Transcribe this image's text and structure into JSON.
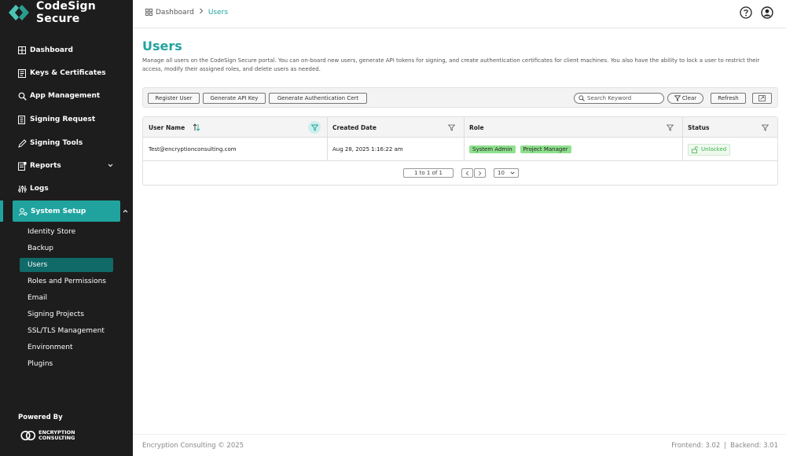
{
  "brand": {
    "name": "CodeSign Secure",
    "accent": "#20a39e"
  },
  "breadcrumb": {
    "home": "Dashboard",
    "current": "Users"
  },
  "sidebar": {
    "items": [
      {
        "label": "Dashboard",
        "icon": "dashboard-icon"
      },
      {
        "label": "Keys & Certificates",
        "icon": "keys-icon"
      },
      {
        "label": "App Management",
        "icon": "app-management-icon"
      },
      {
        "label": "Signing Request",
        "icon": "signing-request-icon"
      },
      {
        "label": "Signing Tools",
        "icon": "signing-tools-icon"
      },
      {
        "label": "Reports",
        "icon": "reports-icon"
      },
      {
        "label": "Logs",
        "icon": "logs-icon"
      },
      {
        "label": "System Setup",
        "icon": "system-setup-icon"
      }
    ],
    "sub_items": [
      "Identity Store",
      "Backup",
      "Users",
      "Roles and Permissions",
      "Email",
      "Signing Projects",
      "SSL/TLS Management",
      "Environment",
      "Plugins"
    ],
    "powered_by": "Powered By",
    "powered_logo_line1": "ENCRYPTION",
    "powered_logo_line2": "CONSULTING"
  },
  "page": {
    "title": "Users",
    "description": "Manage all users on the CodeSign Secure portal. You can on-board new users, generate API tokens for signing, and create authentication certificates for client machines. You also have the ability to lock a user to restrict their access, modify their assigned roles, and delete users as needed."
  },
  "toolbar": {
    "register_user": "Register User",
    "generate_api_key": "Generate API Key",
    "generate_auth_cert": "Generate Authentication Cert",
    "search_placeholder": "Search Keyword",
    "clear": "Clear",
    "refresh": "Refresh"
  },
  "table": {
    "columns": [
      "User Name",
      "Created Date",
      "Role",
      "Status"
    ],
    "rows": [
      {
        "user_name": "Test@encryptionconsulting.com",
        "created_date": "Aug 28, 2025 1:16:22 am",
        "roles": [
          "System Admin",
          "Project Manager"
        ],
        "status": "Unlocked"
      }
    ],
    "pagination": {
      "range": "1 to 1 of 1",
      "page_size": "10"
    }
  },
  "footer": {
    "copyright": "Encryption Consulting © 2025",
    "frontend": "Frontend: 3.02",
    "separator": "|",
    "backend": "Backend: 3.01"
  }
}
